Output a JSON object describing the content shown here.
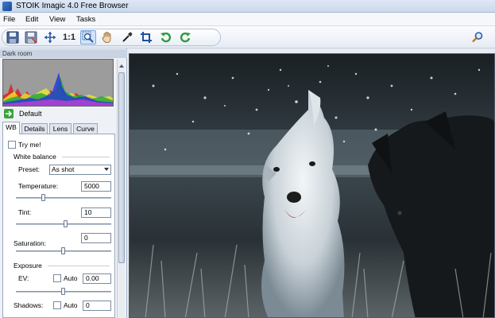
{
  "window": {
    "title": "STOIK Imagic 4.0 Free Browser"
  },
  "menu": {
    "items": [
      "File",
      "Edit",
      "View",
      "Tasks"
    ]
  },
  "toolbar": {
    "ratio_label": "1:1"
  },
  "panel": {
    "header": "Dark room",
    "preset": "Default",
    "tabs": [
      "WB",
      "Details",
      "Lens",
      "Curve"
    ],
    "active_tab": "WB"
  },
  "wb": {
    "try_me": "Try me!",
    "white_balance": "White balance",
    "preset_label": "Preset:",
    "preset_value": "As shot",
    "temperature_label": "Temperature:",
    "temperature_value": "5000",
    "tint_label": "Tint:",
    "tint_value": "10",
    "saturation_label": "Saturation:",
    "saturation_value": "0",
    "exposure": "Exposure",
    "ev_label": "EV:",
    "ev_auto": "Auto",
    "ev_value": "0.00",
    "shadows_label": "Shadows:",
    "shadows_auto": "Auto",
    "shadows_value": "0"
  },
  "colors": {
    "accent": "#3a7bd5",
    "rotate": "#2e9a3e"
  }
}
